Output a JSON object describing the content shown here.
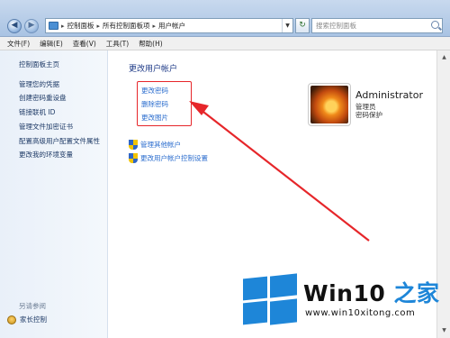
{
  "address_bar": {
    "crumbs": [
      "控制面板",
      "所有控制面板项",
      "用户帐户"
    ],
    "search_placeholder": "搜索控制面板"
  },
  "menu": [
    "文件(F)",
    "编辑(E)",
    "查看(V)",
    "工具(T)",
    "帮助(H)"
  ],
  "sidebar": {
    "home": "控制面板主页",
    "tasks": [
      "管理您的凭据",
      "创建密码重设盘",
      "链接联机 ID",
      "管理文件加密证书",
      "配置高级用户配置文件属性",
      "更改我的环境变量"
    ],
    "see_also": "另请参阅",
    "parental_control": "家长控制"
  },
  "main": {
    "title": "更改用户帐户",
    "links": [
      "更改密码",
      "删除密码",
      "更改图片"
    ],
    "admin_links": [
      "管理其他帐户",
      "更改用户帐户控制设置"
    ]
  },
  "account": {
    "name": "Administrator",
    "role": "管理员",
    "status": "密码保护"
  },
  "watermark": {
    "brand_prefix": "Win10",
    "brand_suffix": " 之家",
    "url": "www.win10xitong.com"
  },
  "colors": {
    "link": "#2b6dce",
    "highlight_box": "#e6262a",
    "watermark_blue": "#1e86d8"
  }
}
